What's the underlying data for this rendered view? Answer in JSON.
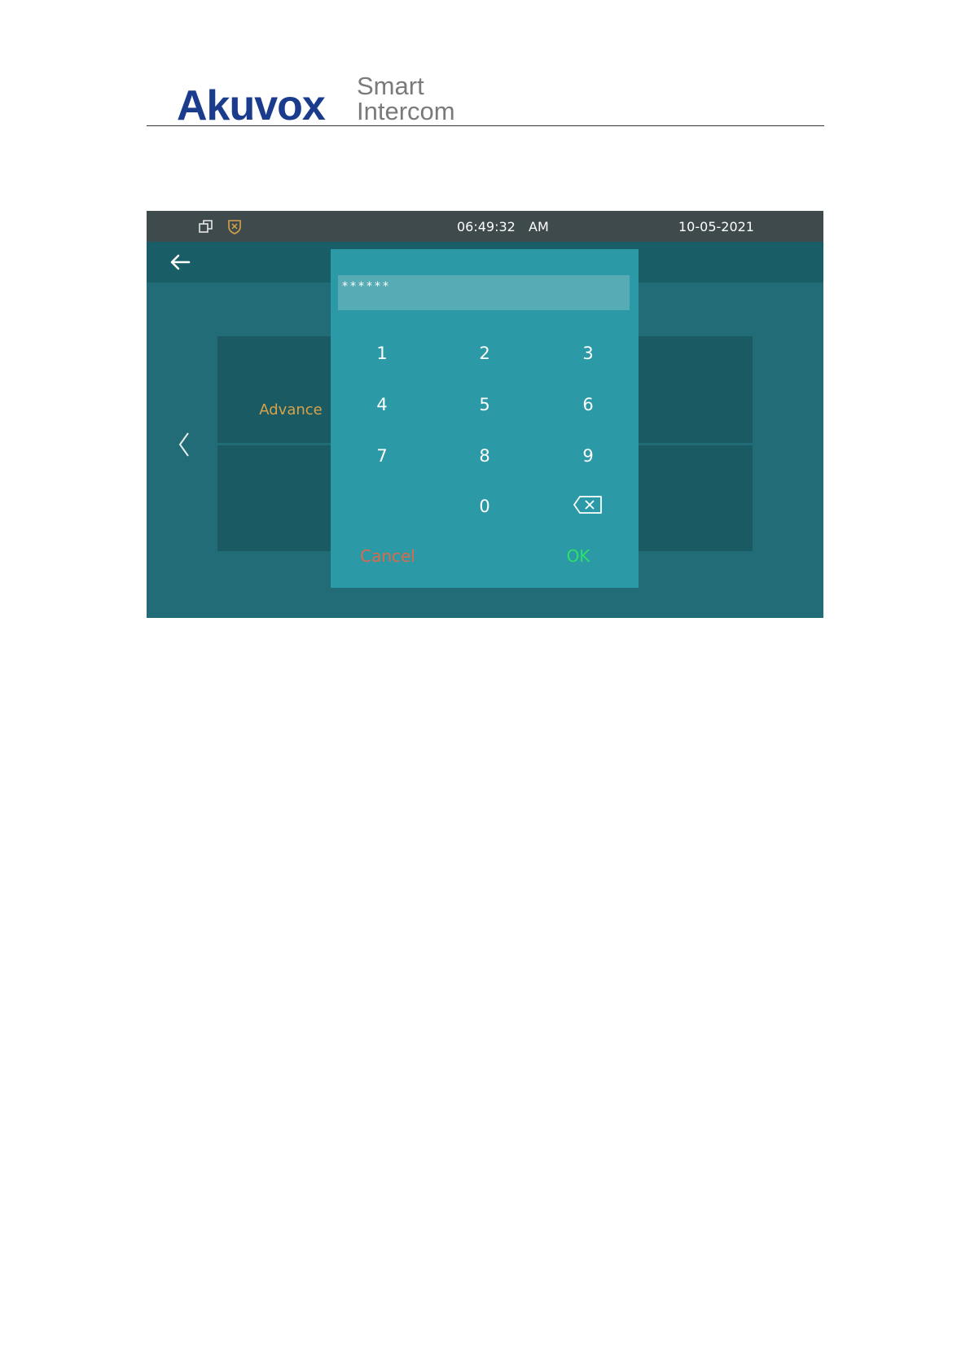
{
  "header": {
    "brand": "Akuvox",
    "tagline_line1": "Smart",
    "tagline_line2": "Intercom"
  },
  "status_bar": {
    "time": "06:49:32",
    "ampm": "AM",
    "date": "10-05-2021",
    "icons": [
      "window-restore-icon",
      "shield-alert-icon"
    ]
  },
  "settings_tiles": {
    "advance": {
      "label": "Advance",
      "icon": "more-dots-icon"
    }
  },
  "keypad_dialog": {
    "password_value": "******",
    "keys": [
      "1",
      "2",
      "3",
      "4",
      "5",
      "6",
      "7",
      "8",
      "9",
      "0"
    ],
    "backspace_icon": "backspace-icon",
    "cancel_label": "Cancel",
    "ok_label": "OK"
  },
  "colors": {
    "screen_bg": "#226c77",
    "dialog_bg": "#2b9aa6",
    "accent_gold": "#d7a24a",
    "cancel": "#d96b4b",
    "ok": "#2ee06a",
    "brand_blue": "#1b3c8c"
  }
}
